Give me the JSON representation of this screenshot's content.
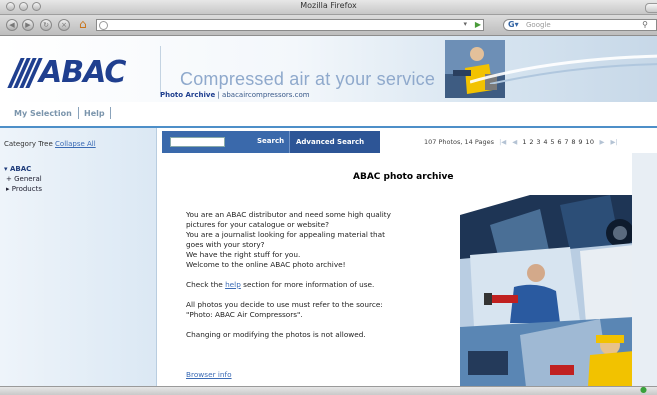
{
  "browser": {
    "window_title": "Mozilla Firefox",
    "search_placeholder": "Google"
  },
  "header": {
    "logo_text": "ABAC",
    "tagline": "Compressed air at your service",
    "sub_label": "Photo Archive",
    "sub_url": "| abacaircompressors.com"
  },
  "nav": {
    "my_selection": "My Selection",
    "help": "Help"
  },
  "sidebar": {
    "title": "Category Tree",
    "collapse": "Collapse All",
    "root": "ABAC",
    "items": [
      {
        "label": "General",
        "marker": "+"
      },
      {
        "label": "Products",
        "marker": "▸"
      }
    ]
  },
  "search": {
    "button": "Search",
    "advanced": "Advanced Search",
    "count": "107 Photos, 14 Pages",
    "pages": "1 2 3 4 5 6 7 8 9 10"
  },
  "main": {
    "title": "ABAC photo archive",
    "para1_lines": [
      "You are an ABAC distributor and need some high quality",
      "pictures for your catalogue or website?",
      "You are a journalist looking for appealing material that",
      "goes with your story?",
      "We have the right stuff for you.",
      "Welcome to the online ABAC photo archive!"
    ],
    "check_before": "Check the ",
    "help_link": "help",
    "check_after": " section for more information of use.",
    "para3_lines": [
      "All photos you decide to use must refer to the source:",
      "\"Photo: ABAC Air Compressors\"."
    ],
    "para4": "Changing or modifying the photos is not allowed.",
    "browser_info": "Browser info"
  },
  "colors": {
    "brand_blue": "#1f3f8f",
    "nav_accent": "#4d8fc8",
    "search_bar": "#3a69ab",
    "link": "#3b6bb5"
  }
}
